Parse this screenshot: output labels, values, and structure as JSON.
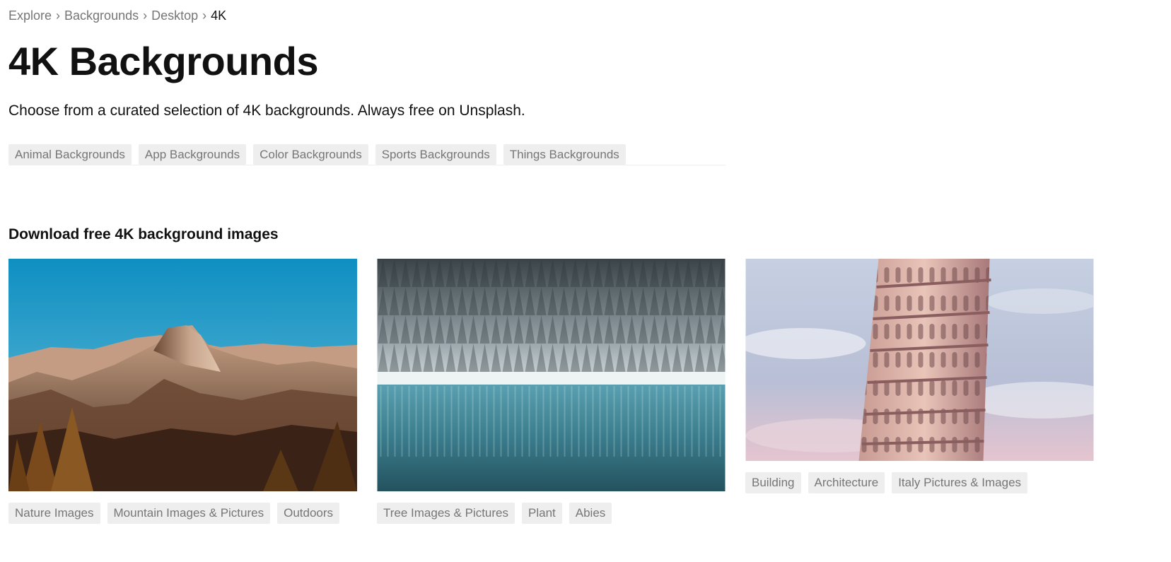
{
  "breadcrumb": {
    "items": [
      "Explore",
      "Backgrounds",
      "Desktop"
    ],
    "current": "4K",
    "separator": "›"
  },
  "page": {
    "title": "4K Backgrounds",
    "subtitle": "Choose from a curated selection of 4K backgrounds. Always free on Unsplash."
  },
  "related_categories": [
    "Animal Backgrounds",
    "App Backgrounds",
    "Color Backgrounds",
    "Sports Backgrounds",
    "Things Backgrounds"
  ],
  "section": {
    "heading": "Download free 4K background images"
  },
  "photos": [
    {
      "subject": "mountain-half-dome",
      "tags": [
        "Nature Images",
        "Mountain Images & Pictures",
        "Outdoors"
      ]
    },
    {
      "subject": "snowy-forest-lake",
      "tags": [
        "Tree Images & Pictures",
        "Plant",
        "Abies"
      ]
    },
    {
      "subject": "leaning-tower-of-pisa",
      "tags": [
        "Building",
        "Architecture",
        "Italy Pictures & Images"
      ]
    }
  ],
  "colors": {
    "chip_bg": "#eeeeee",
    "chip_text": "#767676",
    "text": "#111111"
  }
}
